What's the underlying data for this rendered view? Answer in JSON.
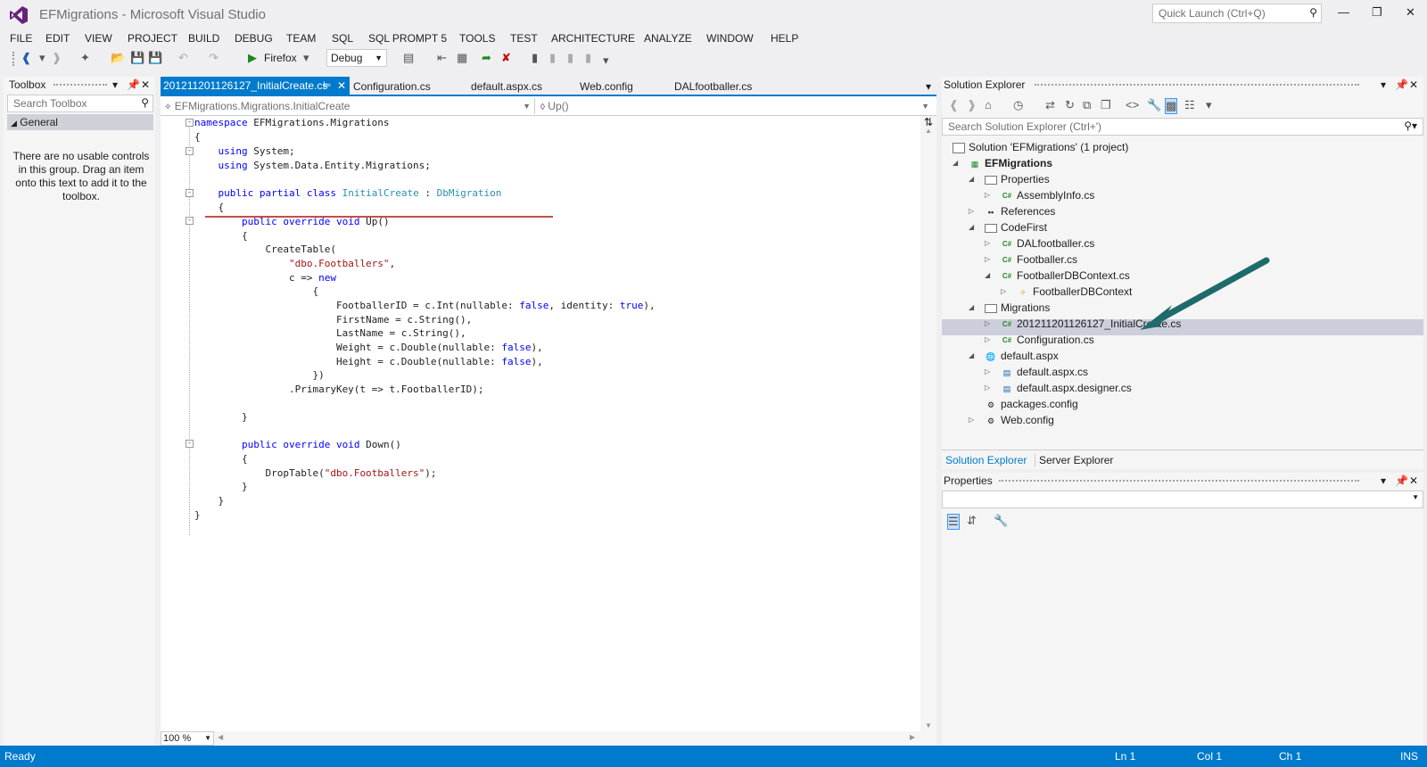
{
  "window": {
    "title": "EFMigrations - Microsoft Visual Studio",
    "quick_launch_placeholder": "Quick Launch (Ctrl+Q)"
  },
  "menu": [
    "FILE",
    "EDIT",
    "VIEW",
    "PROJECT",
    "BUILD",
    "DEBUG",
    "TEAM",
    "SQL",
    "SQL PROMPT 5",
    "TOOLS",
    "TEST",
    "ARCHITECTURE",
    "ANALYZE",
    "WINDOW",
    "HELP"
  ],
  "toolbar": {
    "browser": "Firefox",
    "config": "Debug"
  },
  "toolbox": {
    "title": "Toolbox",
    "search_placeholder": "Search Toolbox",
    "group": "General",
    "empty_text": "There are no usable controls in this group. Drag an item onto this text to add it to the toolbox."
  },
  "editor": {
    "tabs": [
      "201211201126127_InitialCreate.cs",
      "Configuration.cs",
      "default.aspx.cs",
      "Web.config",
      "DALfootballer.cs"
    ],
    "nav_left": "EFMigrations.Migrations.InitialCreate",
    "nav_right": "Up()",
    "zoom": "100 %"
  },
  "solution_explorer": {
    "title": "Solution Explorer",
    "search_placeholder": "Search Solution Explorer (Ctrl+')",
    "items": [
      {
        "label": "Solution 'EFMigrations' (1 project)"
      },
      {
        "label": "EFMigrations"
      },
      {
        "label": "Properties"
      },
      {
        "label": "AssemblyInfo.cs"
      },
      {
        "label": "References"
      },
      {
        "label": "CodeFirst"
      },
      {
        "label": "DALfootballer.cs"
      },
      {
        "label": "Footballer.cs"
      },
      {
        "label": "FootballerDBContext.cs"
      },
      {
        "label": "FootballerDBContext"
      },
      {
        "label": "Migrations"
      },
      {
        "label": "201211201126127_InitialCreate.cs"
      },
      {
        "label": "Configuration.cs"
      },
      {
        "label": "default.aspx"
      },
      {
        "label": "default.aspx.cs"
      },
      {
        "label": "default.aspx.designer.cs"
      },
      {
        "label": "packages.config"
      },
      {
        "label": "Web.config"
      }
    ],
    "tab_active": "Solution Explorer",
    "tab_other": "Server Explorer"
  },
  "properties": {
    "title": "Properties"
  },
  "status": {
    "state": "Ready",
    "line": "Ln 1",
    "col": "Col 1",
    "ch": "Ch 1",
    "mode": "INS"
  },
  "colors": {
    "accent": "#007acc",
    "keyword": "#0000ff",
    "type": "#2b91af",
    "string": "#a31515",
    "arrow": "#1f6b6b"
  }
}
